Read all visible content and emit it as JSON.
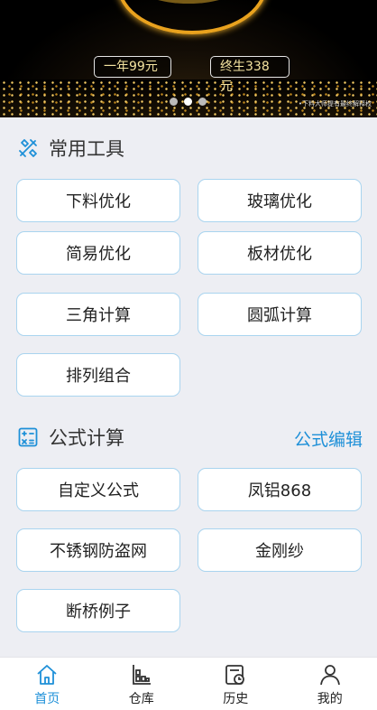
{
  "banner": {
    "prices": [
      "一年99元",
      "终生338元"
    ],
    "note": "•下料大师提有最终解释权"
  },
  "tools": {
    "title": "常用工具",
    "items": [
      "下料优化",
      "玻璃优化",
      "简易优化",
      "板材优化",
      "三角计算",
      "圆弧计算",
      "排列组合"
    ]
  },
  "formula": {
    "title": "公式计算",
    "edit_label": "公式编辑",
    "items": [
      "自定义公式",
      "凤铝868",
      "不锈钢防盗网",
      "金刚纱",
      "断桥例子"
    ]
  },
  "nav": {
    "items": [
      "首页",
      "仓库",
      "历史",
      "我的"
    ],
    "active": 0
  },
  "colors": {
    "accent": "#1e90d8",
    "border": "#a9d4ef",
    "background": "#edeef3"
  }
}
